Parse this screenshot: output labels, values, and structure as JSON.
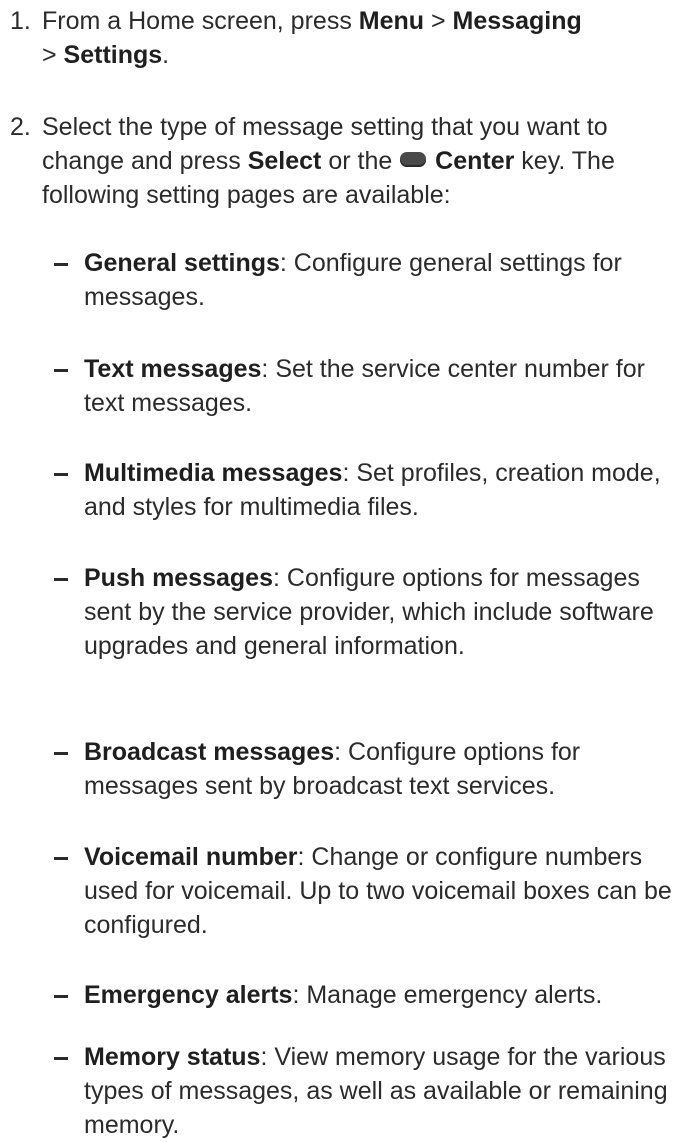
{
  "steps": [
    {
      "number": "1.",
      "pre": "From a Home screen, press ",
      "menu": "Menu",
      "sep1": " > ",
      "messaging": "Messaging",
      "sep2": " > ",
      "settings": "Settings",
      "end": "."
    },
    {
      "number": "2.",
      "pre": "Select the type of message setting that you want to change and press ",
      "select": "Select",
      "mid": " or the ",
      "center": "Center",
      "post": " key. The following setting pages are available:"
    }
  ],
  "bullets": [
    {
      "term": "General settings",
      "desc": ": Configure general settings for messages."
    },
    {
      "term": "Text messages",
      "desc": ": Set the service center number for text messages."
    },
    {
      "term": "Multimedia messages",
      "desc": ": Set profiles, creation mode, and styles for multimedia files."
    },
    {
      "term": "Push messages",
      "desc": ": Configure options for messages sent by the service provider, which include software upgrades and general information."
    },
    {
      "term": "Broadcast messages",
      "desc": ": Configure options for messages sent by broadcast text services."
    },
    {
      "term": "Voicemail number",
      "desc": ": Change or configure numbers used for voicemail. Up to two voicemail boxes can be configured."
    },
    {
      "term": "Emergency alerts",
      "desc": ": Manage emergency alerts."
    },
    {
      "term": "Memory status",
      "desc": ": View memory usage for the various types of messages, as well as available or remaining memory."
    }
  ]
}
